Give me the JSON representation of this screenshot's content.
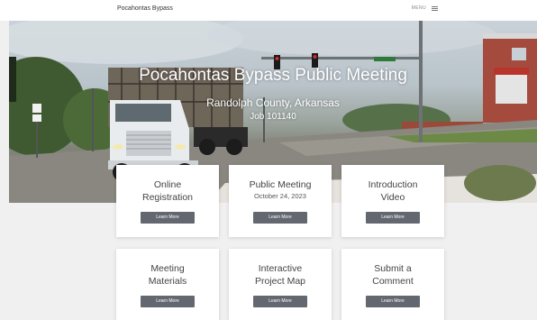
{
  "header": {
    "site_title": "Pocahontas Bypass",
    "menu_label": "MENU",
    "menu_icon": "hamburger-icon"
  },
  "hero": {
    "title": "Pocahontas Bypass Public Meeting",
    "subtitle": "Randolph County, Arkansas",
    "job": "Job 101140"
  },
  "cards": [
    {
      "title_line1": "Online",
      "title_line2": "Registration",
      "subtitle": "",
      "button": "Learn More"
    },
    {
      "title_line1": "Public Meeting",
      "title_line2": "",
      "subtitle": "October 24, 2023",
      "button": "Learn More"
    },
    {
      "title_line1": "Introduction",
      "title_line2": "Video",
      "subtitle": "",
      "button": "Learn More"
    },
    {
      "title_line1": "Meeting",
      "title_line2": "Materials",
      "subtitle": "",
      "button": "Learn More"
    },
    {
      "title_line1": "Interactive",
      "title_line2": "Project Map",
      "subtitle": "",
      "button": "Learn More"
    },
    {
      "title_line1": "Submit a",
      "title_line2": "Comment",
      "subtitle": "",
      "button": "Learn More"
    }
  ],
  "colors": {
    "button_bg": "#636770",
    "page_bg": "#f0f0f0"
  }
}
